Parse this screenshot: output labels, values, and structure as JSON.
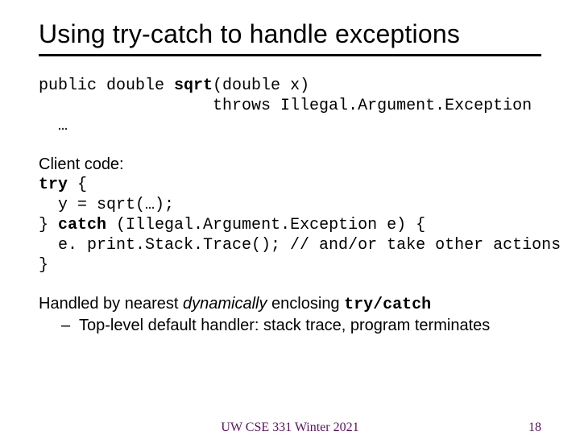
{
  "title": "Using try-catch to handle exceptions",
  "sig": {
    "line1_pre": "public double ",
    "line1_name": "sqrt",
    "line1_post": "(double x)",
    "line2": "                  throws Illegal.Argument.Exception",
    "line3": "  …"
  },
  "client": {
    "label": "Client code:",
    "l1a": "try",
    "l1b": " {",
    "l2": "  y = sqrt(…);",
    "l3a": "} ",
    "l3b": "catch",
    "l3c": " (Illegal.Argument.Exception e) {",
    "l4": "  e. print.Stack.Trace(); // and/or take other actions",
    "l5": "}"
  },
  "handled": {
    "pre": "Handled by nearest ",
    "dyn": "dynamically",
    "mid": " enclosing ",
    "tc": "try/catch",
    "bullet": "Top-level default handler:  stack trace, program terminates"
  },
  "footer": {
    "center": "UW CSE 331 Winter 2021",
    "page": "18"
  }
}
